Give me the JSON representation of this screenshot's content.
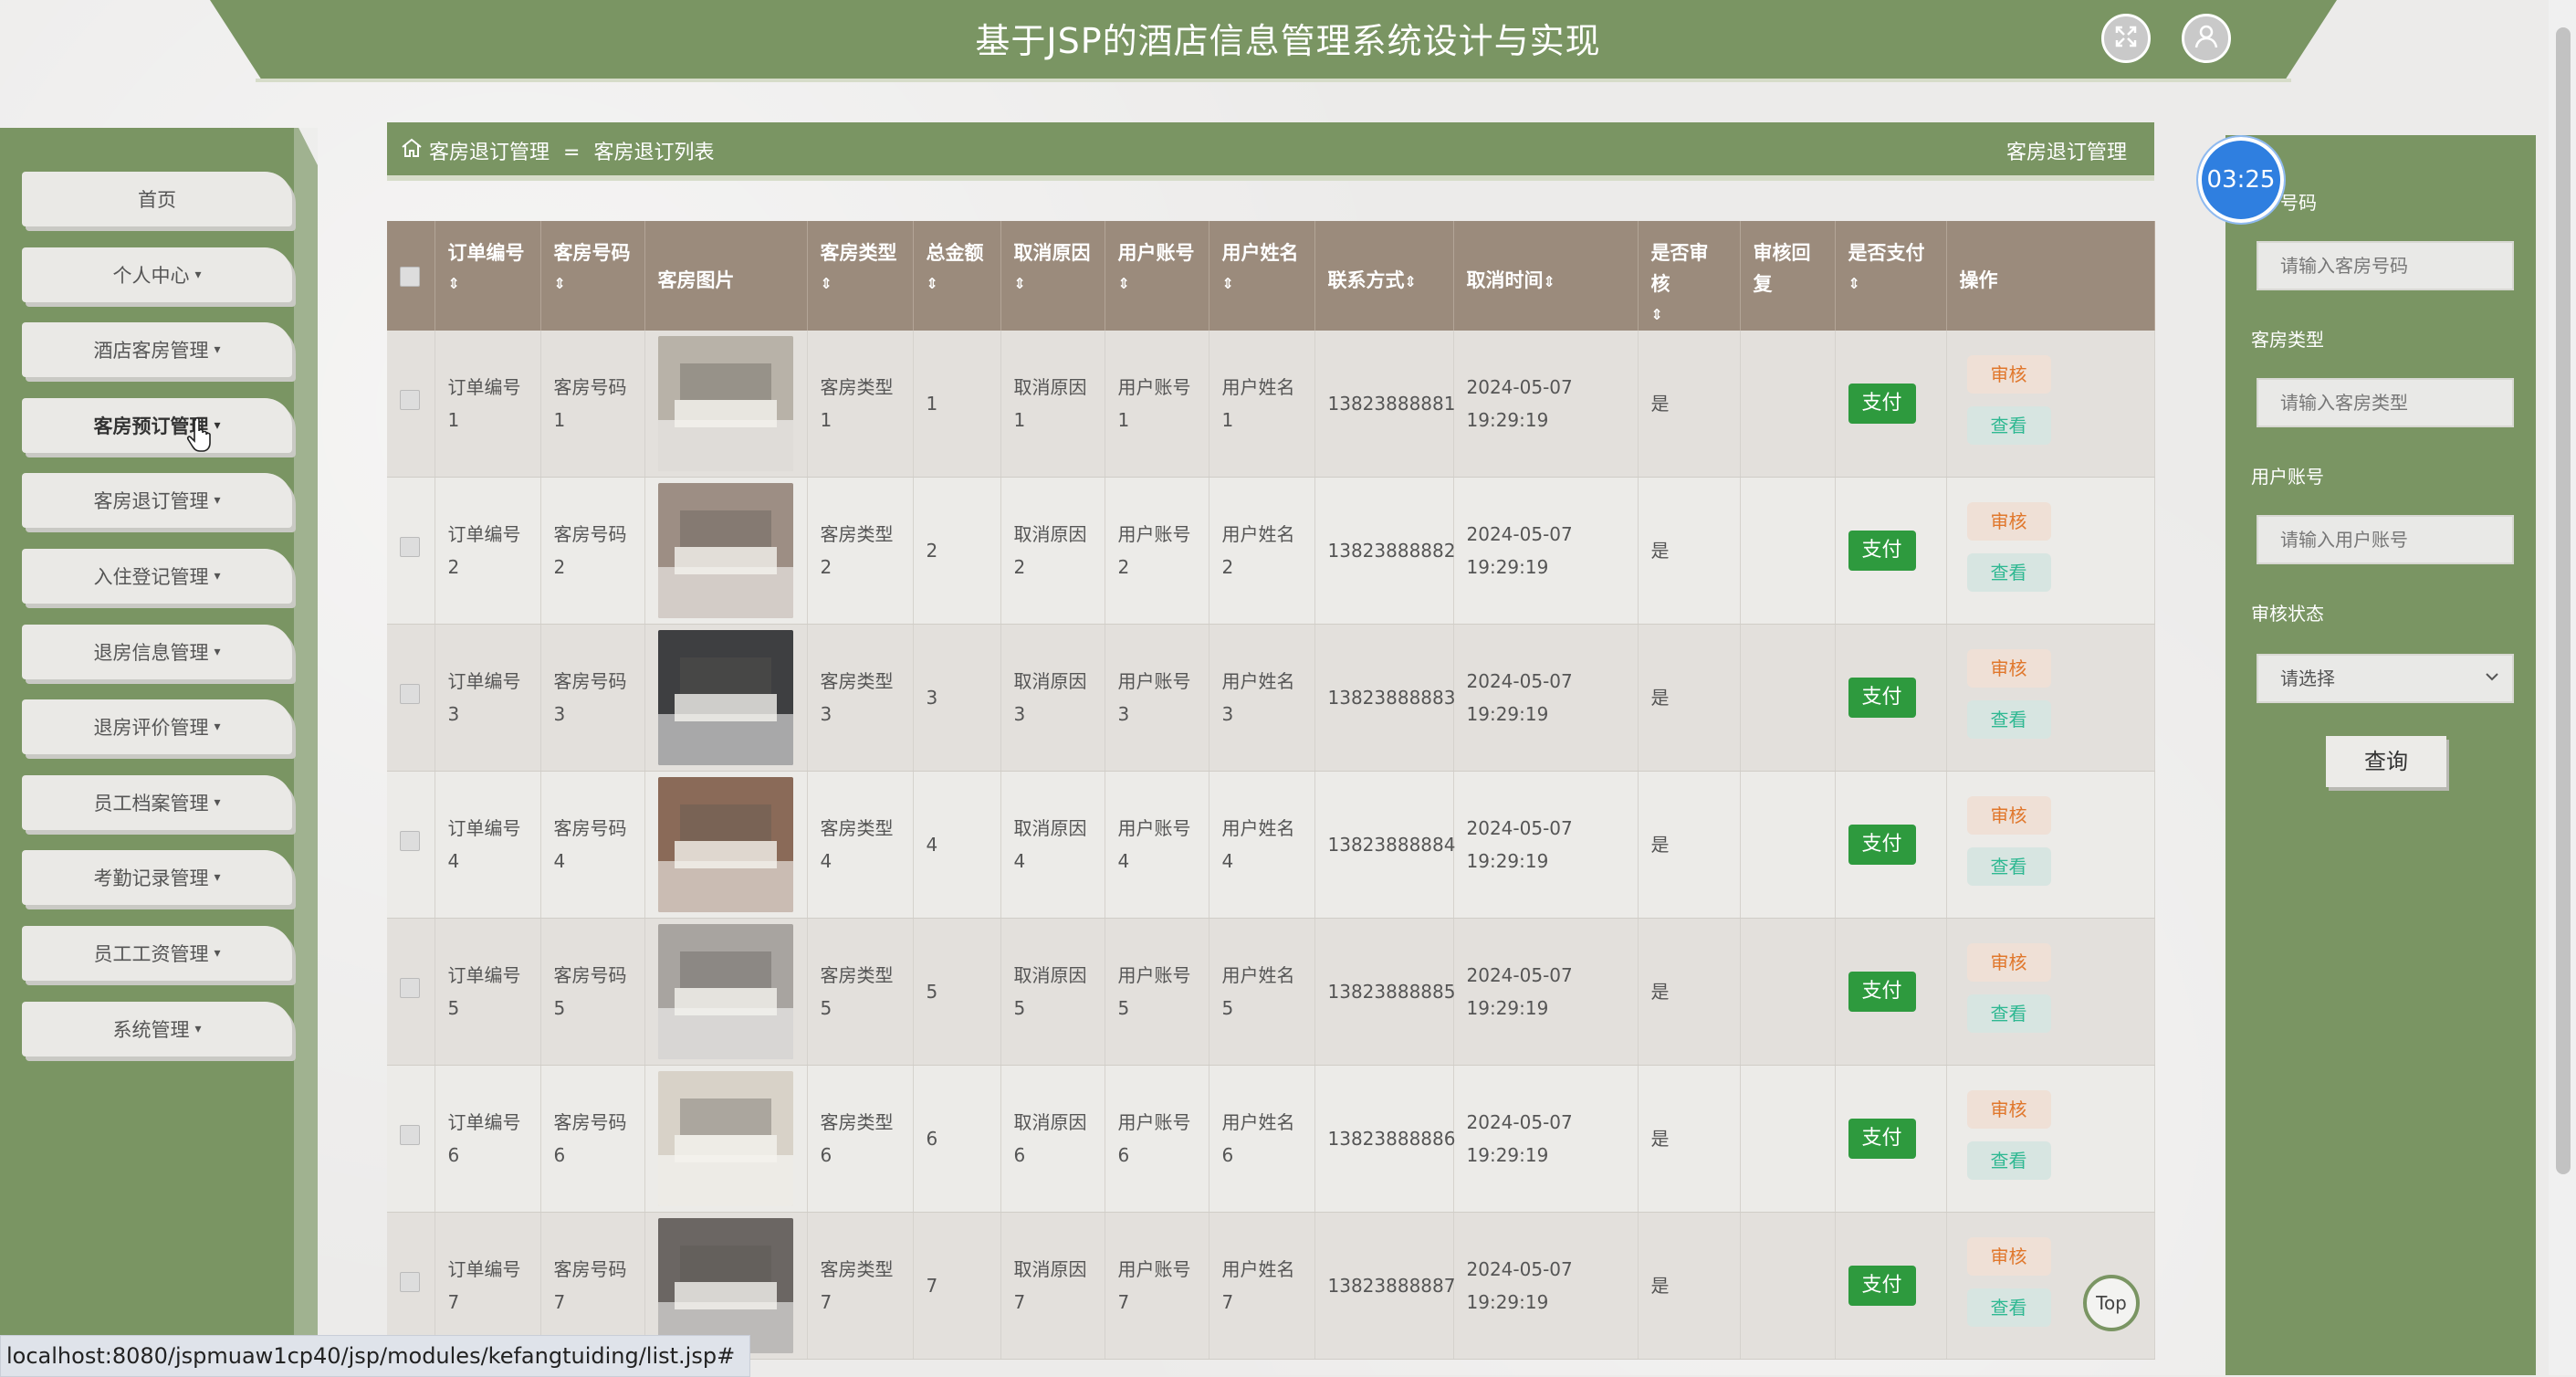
{
  "header": {
    "title": "基于JSP的酒店信息管理系统设计与实现",
    "fullscreen_icon": "expand-icon",
    "user_icon": "user-icon"
  },
  "sidebar": {
    "items": [
      {
        "label": "首页",
        "caret": false
      },
      {
        "label": "个人中心",
        "caret": true
      },
      {
        "label": "酒店客房管理",
        "caret": true
      },
      {
        "label": "客房预订管理",
        "caret": true,
        "active": true
      },
      {
        "label": "客房退订管理",
        "caret": true
      },
      {
        "label": "入住登记管理",
        "caret": true
      },
      {
        "label": "退房信息管理",
        "caret": true
      },
      {
        "label": "退房评价管理",
        "caret": true
      },
      {
        "label": "员工档案管理",
        "caret": true
      },
      {
        "label": "考勤记录管理",
        "caret": true
      },
      {
        "label": "员工工资管理",
        "caret": true
      },
      {
        "label": "系统管理",
        "caret": true
      }
    ]
  },
  "breadcrumb": {
    "root": "客房退订管理",
    "separator": "=",
    "current": "客房退订列表",
    "right_title": "客房退订管理"
  },
  "table": {
    "columns": [
      "订单编号",
      "客房号码",
      "客房图片",
      "客房类型",
      "总金额",
      "取消原因",
      "用户账号",
      "用户姓名",
      "联系方式",
      "取消时间",
      "是否审核",
      "审核回复",
      "是否支付",
      "操作"
    ],
    "rows": [
      {
        "order": "订单编号1",
        "room": "客房号码1",
        "type": "客房类型1",
        "amount": "1",
        "reason": "取消原因1",
        "account": "用户账号1",
        "name": "用户姓名1",
        "phone": "13823888881",
        "time": "2024-05-07 19:29:19",
        "audited": "是",
        "reply": "",
        "pay": "支付",
        "audit_btn": "审核",
        "view_btn": "查看"
      },
      {
        "order": "订单编号2",
        "room": "客房号码2",
        "type": "客房类型2",
        "amount": "2",
        "reason": "取消原因2",
        "account": "用户账号2",
        "name": "用户姓名2",
        "phone": "13823888882",
        "time": "2024-05-07 19:29:19",
        "audited": "是",
        "reply": "",
        "pay": "支付",
        "audit_btn": "审核",
        "view_btn": "查看"
      },
      {
        "order": "订单编号3",
        "room": "客房号码3",
        "type": "客房类型3",
        "amount": "3",
        "reason": "取消原因3",
        "account": "用户账号3",
        "name": "用户姓名3",
        "phone": "13823888883",
        "time": "2024-05-07 19:29:19",
        "audited": "是",
        "reply": "",
        "pay": "支付",
        "audit_btn": "审核",
        "view_btn": "查看"
      },
      {
        "order": "订单编号4",
        "room": "客房号码4",
        "type": "客房类型4",
        "amount": "4",
        "reason": "取消原因4",
        "account": "用户账号4",
        "name": "用户姓名4",
        "phone": "13823888884",
        "time": "2024-05-07 19:29:19",
        "audited": "是",
        "reply": "",
        "pay": "支付",
        "audit_btn": "审核",
        "view_btn": "查看"
      },
      {
        "order": "订单编号5",
        "room": "客房号码5",
        "type": "客房类型5",
        "amount": "5",
        "reason": "取消原因5",
        "account": "用户账号5",
        "name": "用户姓名5",
        "phone": "13823888885",
        "time": "2024-05-07 19:29:19",
        "audited": "是",
        "reply": "",
        "pay": "支付",
        "audit_btn": "审核",
        "view_btn": "查看"
      },
      {
        "order": "订单编号6",
        "room": "客房号码6",
        "type": "客房类型6",
        "amount": "6",
        "reason": "取消原因6",
        "account": "用户账号6",
        "name": "用户姓名6",
        "phone": "13823888886",
        "time": "2024-05-07 19:29:19",
        "audited": "是",
        "reply": "",
        "pay": "支付",
        "audit_btn": "审核",
        "view_btn": "查看"
      },
      {
        "order": "订单编号7",
        "room": "客房号码7",
        "type": "客房类型7",
        "amount": "7",
        "reason": "取消原因7",
        "account": "用户账号7",
        "name": "用户姓名7",
        "phone": "13823888887",
        "time": "2024-05-07 19:29:19",
        "audited": "是",
        "reply": "",
        "pay": "支付",
        "audit_btn": "审核",
        "view_btn": "查看"
      }
    ],
    "photo_colors": [
      "#b8b2a8",
      "#9d8e84",
      "#3e3f41",
      "#8a6a58",
      "#a8a4a0",
      "#d8d2c8",
      "#6b6663"
    ]
  },
  "search": {
    "room_label": "号码",
    "room_placeholder": "请输入客房号码",
    "type_label": "客房类型",
    "type_placeholder": "请输入客房类型",
    "account_label": "用户账号",
    "account_placeholder": "请输入用户账号",
    "status_label": "审核状态",
    "status_selected": "请选择",
    "query_button": "查询"
  },
  "timer": "03:25",
  "top_button": "Top",
  "status_url": "localhost:8080/jspmuaw1cp40/jsp/modules/kefangtuiding/list.jsp#"
}
